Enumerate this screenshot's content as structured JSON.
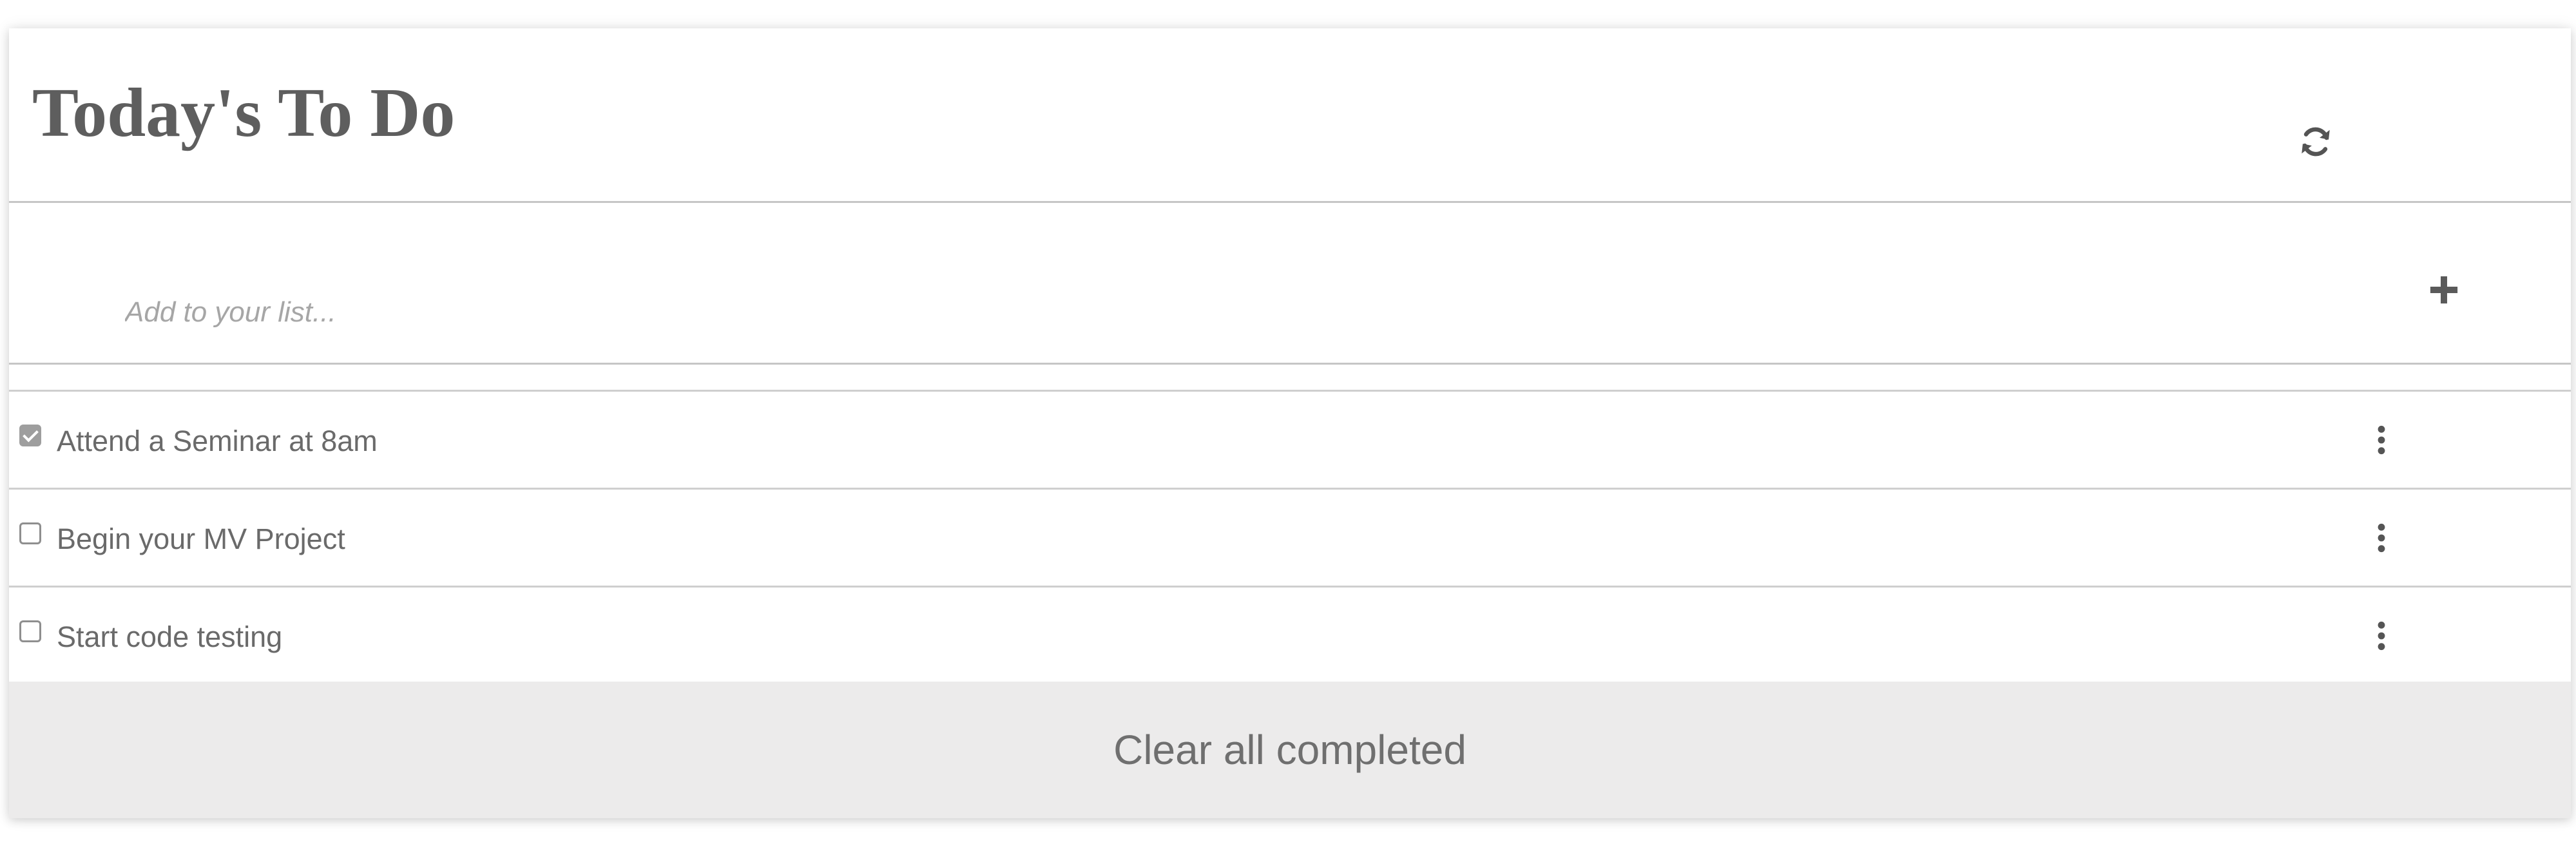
{
  "header": {
    "title": "Today's To Do",
    "refresh_icon": "refresh-icon"
  },
  "add_item": {
    "placeholder": "Add to your list...",
    "value": "",
    "add_icon": "plus-icon"
  },
  "todos": [
    {
      "text": "Attend a Seminar at 8am",
      "completed": true,
      "menu_icon": "more-vertical-icon"
    },
    {
      "text": "Begin your MV Project",
      "completed": false,
      "menu_icon": "more-vertical-icon"
    },
    {
      "text": "Start code testing",
      "completed": false,
      "menu_icon": "more-vertical-icon"
    }
  ],
  "footer": {
    "clear_label": "Clear all completed"
  },
  "colors": {
    "title": "#5e5e5e",
    "text": "#6a6a6a",
    "footer_bg": "#ecebeb",
    "divider": "#c6c6c6"
  }
}
